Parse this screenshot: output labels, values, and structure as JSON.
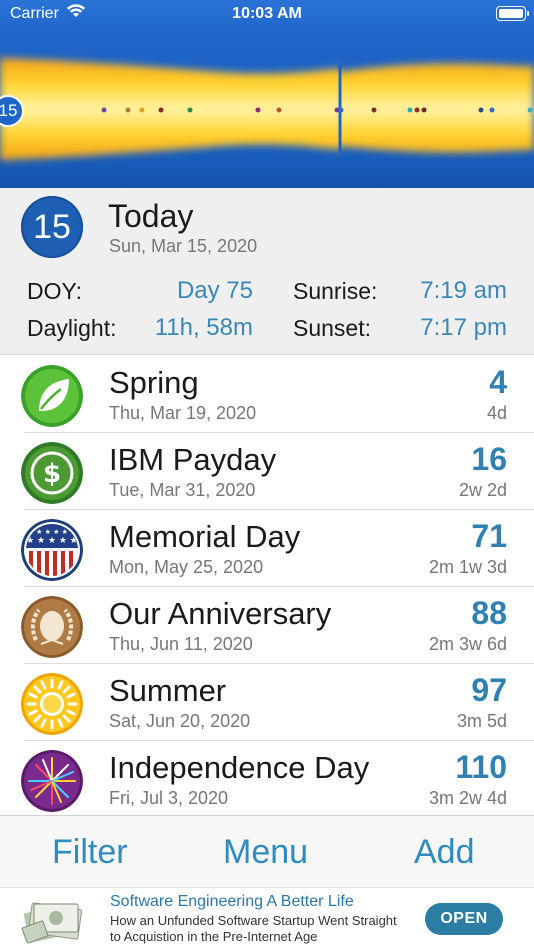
{
  "status_bar": {
    "carrier": "Carrier",
    "time": "10:03 AM",
    "icons": [
      "wifi-icon",
      "battery-icon"
    ]
  },
  "year_band": {
    "today_marker": "15",
    "colors": {
      "sky": "#1f64c7",
      "daylight": "#ffd22e"
    }
  },
  "today": {
    "day_number": "15",
    "title": "Today",
    "date": "Sun, Mar 15, 2020",
    "stats": {
      "doy_label": "DOY:",
      "doy_value": "Day 75",
      "daylight_label": "Daylight:",
      "daylight_value": "11h, 58m",
      "sunrise_label": "Sunrise:",
      "sunrise_value": "7:19 am",
      "sunset_label": "Sunset:",
      "sunset_value": "7:17 pm"
    }
  },
  "events": [
    {
      "icon": "leaf-icon",
      "name": "Spring",
      "date": "Thu, Mar 19, 2020",
      "count": "4",
      "span": "4d"
    },
    {
      "icon": "dollar-icon",
      "name": "IBM Payday",
      "date": "Tue, Mar 31, 2020",
      "count": "16",
      "span": "2w 2d"
    },
    {
      "icon": "flag-shield-icon",
      "name": "Memorial Day",
      "date": "Mon, May 25, 2020",
      "count": "71",
      "span": "2m 1w 3d"
    },
    {
      "icon": "laurel-icon",
      "name": "Our Anniversary",
      "date": "Thu, Jun 11, 2020",
      "count": "88",
      "span": "2m 3w 6d"
    },
    {
      "icon": "sun-icon",
      "name": "Summer",
      "date": "Sat, Jun 20, 2020",
      "count": "97",
      "span": "3m 5d"
    },
    {
      "icon": "fireworks-icon",
      "name": "Independence Day",
      "date": "Fri, Jul 3, 2020",
      "count": "110",
      "span": "3m 2w 4d"
    }
  ],
  "toolbar": {
    "filter": "Filter",
    "menu": "Menu",
    "add": "Add"
  },
  "ad": {
    "title": "Software Engineering A Better Life",
    "body": "How an Unfunded Software Startup Went Straight to Acquistion in the Pre-Internet Age",
    "cta": "OPEN"
  },
  "colors": {
    "accent": "#2f80b3",
    "today_badge": "#1f5fb3"
  }
}
